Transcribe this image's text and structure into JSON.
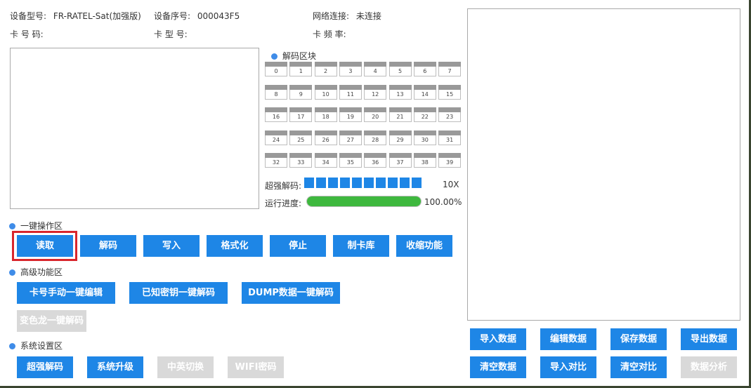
{
  "device": {
    "model_label": "设备型号:",
    "model_value": "FR-RATEL-Sat(加强版)",
    "serial_label": "设备序号:",
    "serial_value": "000043F5",
    "network_label": "网络连接:",
    "network_value": "未连接",
    "card_number_label": "卡 号 码:",
    "card_type_label": "卡 型 号:",
    "card_freq_label": "卡 频 率:"
  },
  "decode_blocks": {
    "title": "解码区块",
    "blocks": [
      "0",
      "1",
      "2",
      "3",
      "4",
      "5",
      "6",
      "7",
      "8",
      "9",
      "10",
      "11",
      "12",
      "13",
      "14",
      "15",
      "16",
      "17",
      "18",
      "19",
      "20",
      "21",
      "22",
      "23",
      "24",
      "25",
      "26",
      "27",
      "28",
      "29",
      "30",
      "31",
      "32",
      "33",
      "34",
      "35",
      "36",
      "37",
      "38",
      "39"
    ],
    "super_decode_label": "超强解码:",
    "super_decode_value": "10X",
    "super_decode_level": 10,
    "super_decode_max": 10,
    "progress_label": "运行进度:",
    "progress_value": "100.00%",
    "progress_fraction": 1.0
  },
  "one_key": {
    "title": "一键操作区",
    "buttons": [
      "读取",
      "解码",
      "写入",
      "格式化",
      "停止",
      "制卡库",
      "收缩功能"
    ]
  },
  "advanced": {
    "title": "高级功能区",
    "buttons": [
      "卡号手动一键编辑",
      "已知密钥一键解码",
      "DUMP数据一键解码"
    ],
    "disabled_button": "变色龙一键解码"
  },
  "settings": {
    "title": "系统设置区",
    "buttons": [
      "超强解码",
      "系统升级"
    ],
    "disabled_buttons": [
      "中英切换",
      "WIFI密码"
    ]
  },
  "data_panel": {
    "buttons_row1": [
      "导入数据",
      "编辑数据",
      "保存数据",
      "导出数据"
    ],
    "buttons_row2": [
      "清空数据",
      "导入对比",
      "清空对比"
    ],
    "disabled_button": "数据分析"
  },
  "colors": {
    "accent": "#1e86e6",
    "progress": "#3eb83e",
    "highlight": "#d9262c",
    "disabled": "#d9d9d9"
  }
}
